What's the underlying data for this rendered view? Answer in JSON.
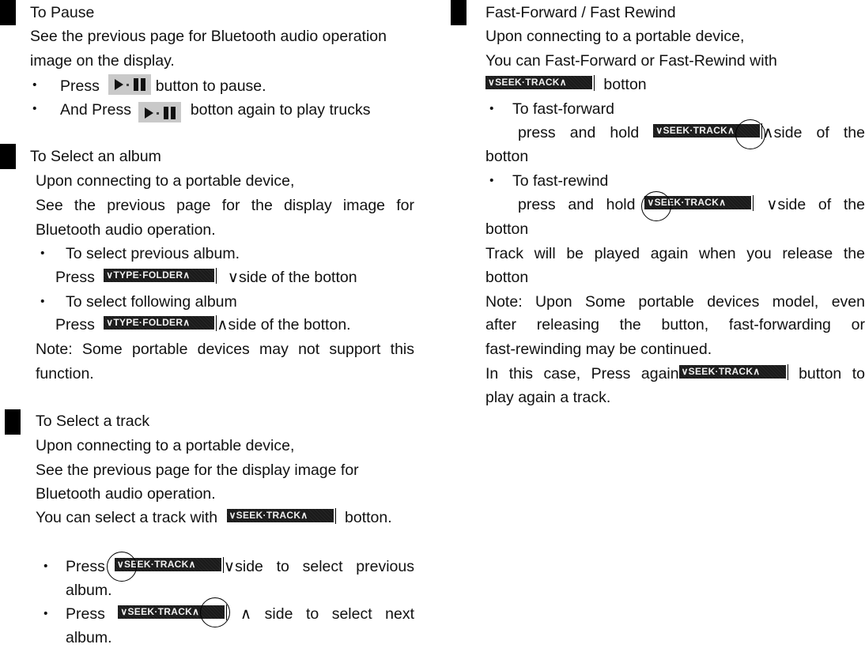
{
  "buttons": {
    "play_pause": "play-pause",
    "type_folder": "∨TYPE·FOLDER∧",
    "seek_track": "∨SEEK·TRACK∧"
  },
  "bullet": "・",
  "left": {
    "pause": {
      "title": "To Pause",
      "line1": "See the previous page for Bluetooth audio operation",
      "line2": "image on the display.",
      "item1_pre": "Press",
      "item1_post": "button to pause.",
      "item2_pre": "And Press",
      "item2_post": "botton again to play trucks"
    },
    "album": {
      "title": "To Select an album",
      "line1": "Upon connecting to a portable device,",
      "line2": "See the previous page for the display image for",
      "line3": "Bluetooth audio operation.",
      "item1": "To select previous album.",
      "item1_press": "Press",
      "item1_post": "∨side of the botton",
      "item2": "To select following album",
      "item2_press": "Press",
      "item2_post": "∧side of the botton.",
      "note1": "Note: Some portable devices may not support this",
      "note2": "function."
    },
    "track": {
      "title": "To Select a track",
      "line1": "Upon connecting to a portable device,",
      "line2": "See the previous page for the display image for",
      "line3": "Bluetooth audio operation.",
      "line4_pre": "You can select a track with",
      "line4_post": "botton.",
      "item1_pre": "Press",
      "item1_post": "∨side to select previous",
      "item1_cont": "album.",
      "item2_pre": "Press",
      "item2_post": "∧  side to select next",
      "item2_cont": "album."
    }
  },
  "right": {
    "ff": {
      "title": "Fast-Forward / Fast Rewind",
      "line1": "Upon connecting to a portable device,",
      "line2": "You can Fast-Forward or Fast-Rewind with",
      "line3_post": "botton",
      "item1": "To fast-forward",
      "item1_pre": "press and hold",
      "item1_post": "∧side of the",
      "item1_cont": "botton",
      "item2": "To fast-rewind",
      "item2_pre": "press and hold",
      "item2_post": "∨side of the",
      "item2_cont": "botton",
      "release1": "Track will be played again when you release the",
      "release2": "botton",
      "note1": "Note: Upon Some portable devices model, even",
      "note2": "after releasing the button, fast-forwarding or",
      "note3": "fast-rewinding may be continued.",
      "last_pre": "In this case, Press again",
      "last_post": "button to",
      "last_cont": "play again a track."
    }
  }
}
